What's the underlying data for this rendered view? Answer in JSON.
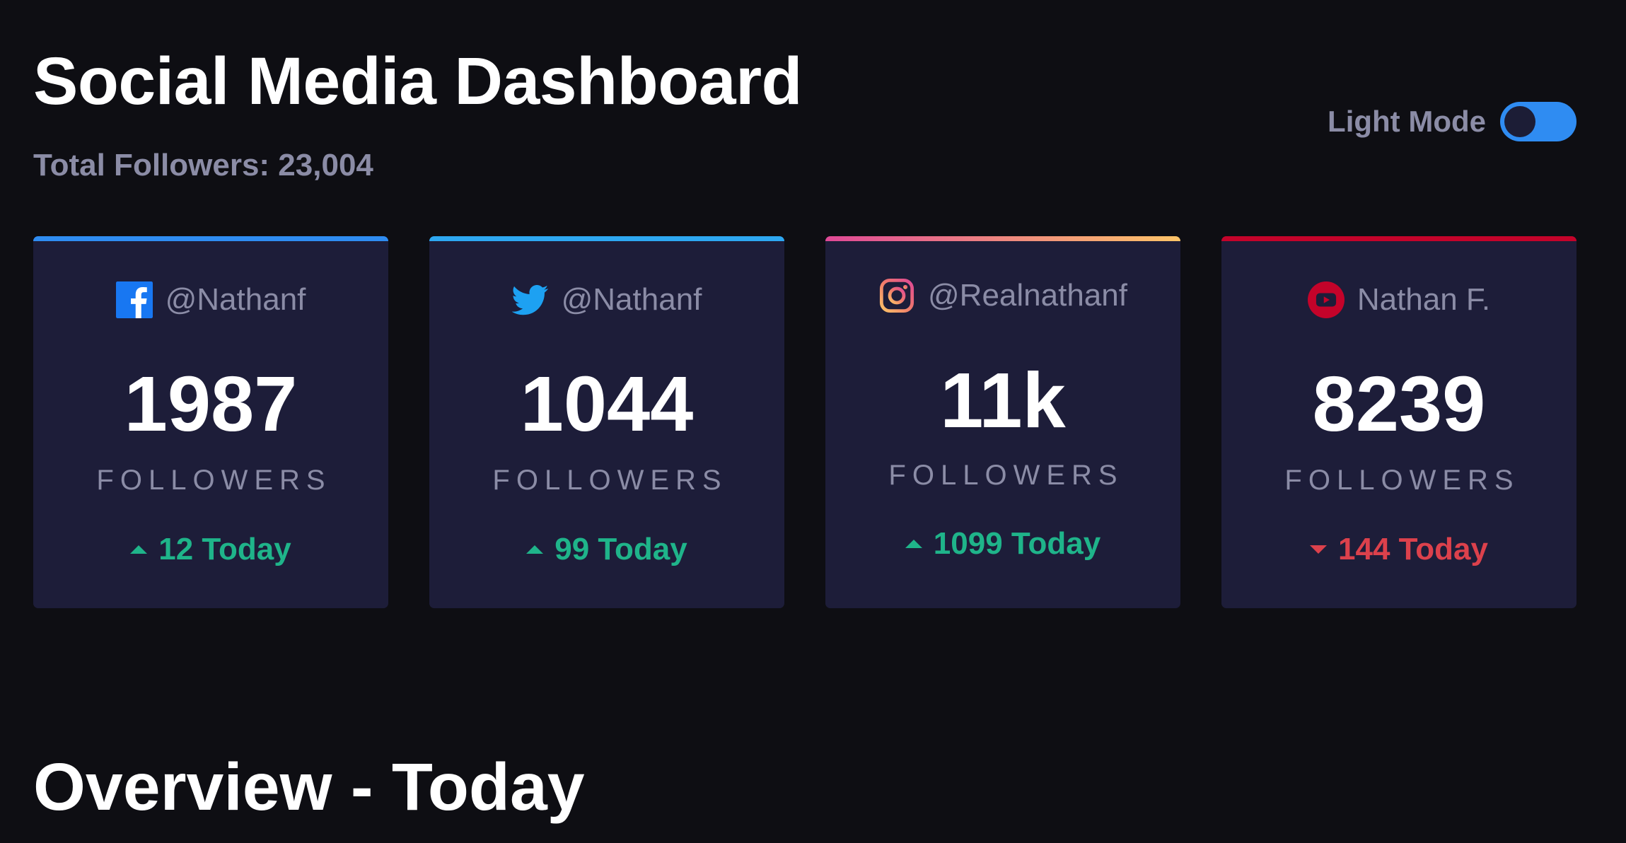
{
  "header": {
    "title": "Social Media Dashboard",
    "total_followers": "Total Followers: 23,004"
  },
  "theme_toggle": {
    "label": "Light Mode",
    "checked": false
  },
  "cards": [
    {
      "platform": "facebook",
      "icon": "facebook-icon",
      "handle": "@Nathanf",
      "count": "1987",
      "count_label": "FOLLOWERS",
      "change": "12 Today",
      "trend": "up",
      "accent": "#2f8cf2"
    },
    {
      "platform": "twitter",
      "icon": "twitter-icon",
      "handle": "@Nathanf",
      "count": "1044",
      "count_label": "FOLLOWERS",
      "change": "99 Today",
      "trend": "up",
      "accent": "#2ea8f2"
    },
    {
      "platform": "instagram",
      "icon": "instagram-icon",
      "handle": "@Realnathanf",
      "count": "11k",
      "count_label": "FOLLOWERS",
      "change": "1099 Today",
      "trend": "up",
      "accent_gradient": [
        "#df4996",
        "#fdc468"
      ]
    },
    {
      "platform": "youtube",
      "icon": "youtube-icon",
      "handle": "Nathan F.",
      "count": "8239",
      "count_label": "FOLLOWERS",
      "change": "144 Today",
      "trend": "down",
      "accent": "#c4032a"
    }
  ],
  "overview": {
    "title": "Overview - Today"
  },
  "colors": {
    "background": "#0e0e13",
    "card": "#1d1d39",
    "muted_text": "#8b8ca6",
    "up": "#1fb48a",
    "down": "#dc414c",
    "toggle": "#2f8cf2"
  }
}
